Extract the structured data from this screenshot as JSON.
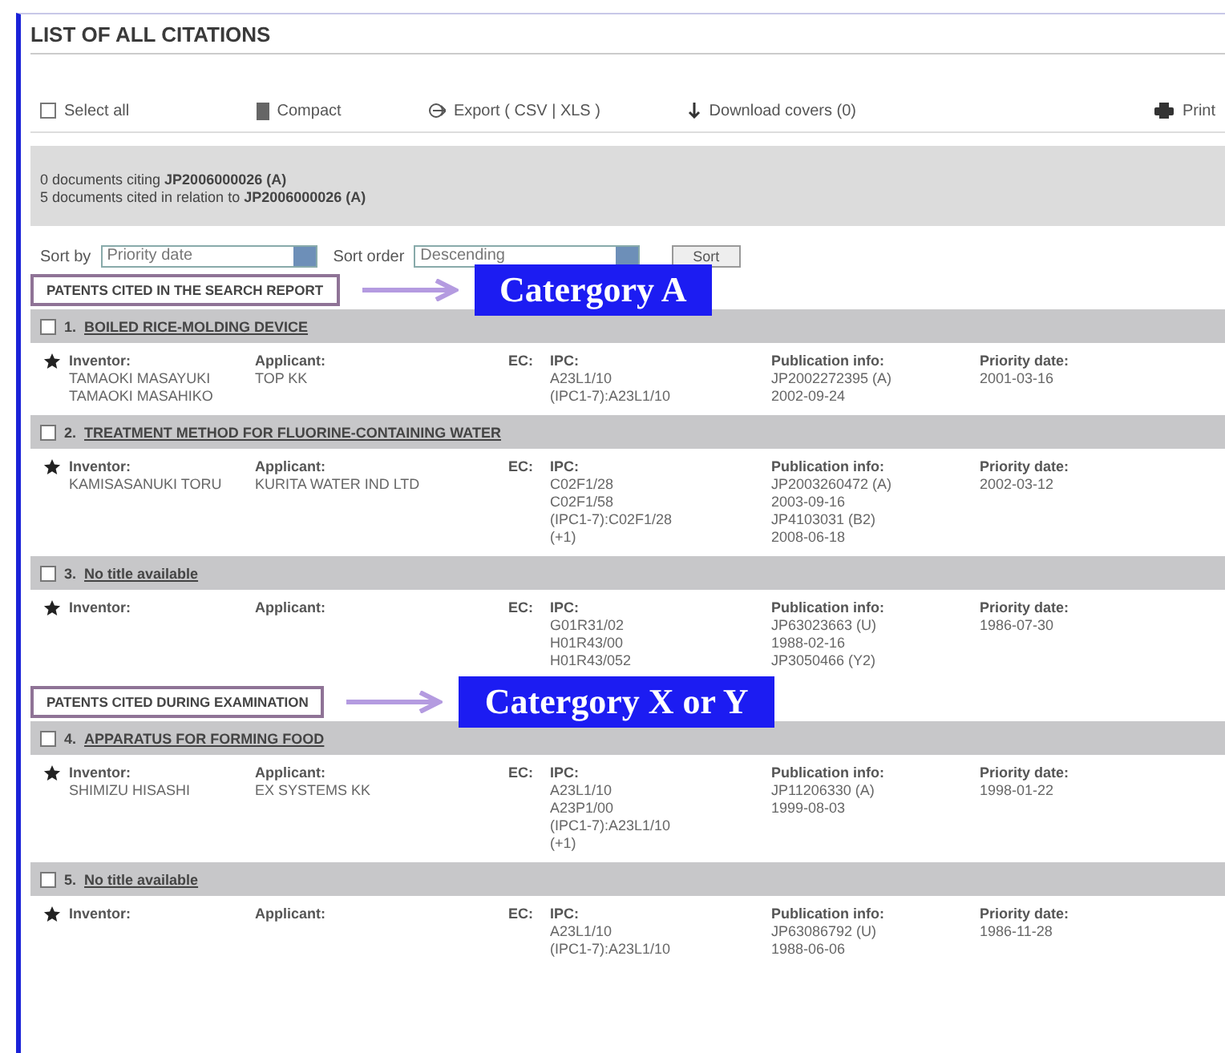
{
  "title": "LIST OF ALL CITATIONS",
  "toolbar": [
    {
      "kind": "checkbox",
      "label": "Select all",
      "checked": false
    },
    {
      "kind": "compact",
      "label": "Compact"
    },
    {
      "kind": "export",
      "label": "Export",
      "extra": "( CSV | XLS )"
    },
    {
      "kind": "download",
      "label": "Download covers (0)"
    },
    {
      "kind": "print",
      "label": "Print"
    }
  ],
  "summary": [
    "0 documents citing **JP2006000026 (A)**",
    "5 documents cited in relation to **JP2006000026 (A)**"
  ],
  "sort": {
    "sort_by_label": "Sort by",
    "sort_by": "Priority date",
    "order_label": "Sort order",
    "order": "Descending",
    "button": "Sort"
  },
  "sections": [
    {
      "heading": "PATENTS CITED IN THE SEARCH REPORT",
      "annotation": "Catergory A",
      "citations": [
        {
          "number": "1.",
          "title": "BOILED RICE-MOLDING DEVICE",
          "checked": false,
          "fields": [
            {
              "kind": "inventor",
              "label": "Inventor:",
              "values": [
                "TAMAOKI MASAYUKI",
                "TAMAOKI MASAHIKO"
              ]
            },
            {
              "kind": "applicant",
              "label": "Applicant:",
              "values": [
                "TOP KK"
              ]
            },
            {
              "kind": "ec",
              "label": "EC:"
            },
            {
              "kind": "ipc",
              "label": "IPC:",
              "values": [
                "A23L1/10",
                "(IPC1-7):A23L1/10"
              ]
            },
            {
              "kind": "publication",
              "label": "Publication info:",
              "values": [
                "JP2002272395 (A)",
                "2002-09-24"
              ]
            },
            {
              "kind": "priority-date",
              "label": "Priority date:",
              "values": [
                "2001-03-16"
              ]
            }
          ]
        },
        {
          "number": "2.",
          "title": "TREATMENT METHOD FOR FLUORINE-CONTAINING WATER",
          "checked": false,
          "fields": [
            {
              "kind": "inventor",
              "label": "Inventor:",
              "values": [
                "KAMISASANUKI TORU"
              ]
            },
            {
              "kind": "applicant",
              "label": "Applicant:",
              "values": [
                "KURITA WATER IND LTD"
              ]
            },
            {
              "kind": "ec",
              "label": "EC:"
            },
            {
              "kind": "ipc",
              "label": "IPC:",
              "values": [
                "C02F1/28",
                "C02F1/58",
                "(IPC1-7):C02F1/28",
                "(+1)"
              ]
            },
            {
              "kind": "publication",
              "label": "Publication info:",
              "values": [
                "JP2003260472 (A)",
                "2003-09-16",
                "JP4103031 (B2)",
                "2008-06-18"
              ]
            },
            {
              "kind": "priority-date",
              "label": "Priority date:",
              "values": [
                "2002-03-12"
              ]
            }
          ]
        },
        {
          "number": "3.",
          "title": "No title available",
          "checked": false,
          "fields": [
            {
              "kind": "inventor",
              "label": "Inventor:"
            },
            {
              "kind": "applicant",
              "label": "Applicant:"
            },
            {
              "kind": "ec",
              "label": "EC:"
            },
            {
              "kind": "ipc",
              "label": "IPC:",
              "values": [
                "G01R31/02",
                "H01R43/00",
                "H01R43/052"
              ]
            },
            {
              "kind": "publication",
              "label": "Publication info:",
              "values": [
                "JP63023663 (U)",
                "1988-02-16",
                "JP3050466 (Y2)"
              ]
            },
            {
              "kind": "priority-date",
              "label": "Priority date:",
              "values": [
                "1986-07-30"
              ]
            }
          ]
        }
      ]
    },
    {
      "heading": "PATENTS CITED DURING EXAMINATION",
      "annotation": "Catergory X or Y",
      "citations": [
        {
          "number": "4.",
          "title": "APPARATUS FOR FORMING FOOD",
          "checked": false,
          "fields": [
            {
              "kind": "inventor",
              "label": "Inventor:",
              "values": [
                "SHIMIZU HISASHI"
              ]
            },
            {
              "kind": "applicant",
              "label": "Applicant:",
              "values": [
                "EX SYSTEMS KK"
              ]
            },
            {
              "kind": "ec",
              "label": "EC:"
            },
            {
              "kind": "ipc",
              "label": "IPC:",
              "values": [
                "A23L1/10",
                "A23P1/00",
                "(IPC1-7):A23L1/10",
                "(+1)"
              ]
            },
            {
              "kind": "publication",
              "label": "Publication info:",
              "values": [
                "JP11206330 (A)",
                "1999-08-03"
              ]
            },
            {
              "kind": "priority-date",
              "label": "Priority date:",
              "values": [
                "1998-01-22"
              ]
            }
          ]
        },
        {
          "number": "5.",
          "title": "No title available",
          "checked": false,
          "fields": [
            {
              "kind": "inventor",
              "label": "Inventor:"
            },
            {
              "kind": "applicant",
              "label": "Applicant:"
            },
            {
              "kind": "ec",
              "label": "EC:"
            },
            {
              "kind": "ipc",
              "label": "IPC:",
              "values": [
                "A23L1/10",
                "(IPC1-7):A23L1/10"
              ]
            },
            {
              "kind": "publication",
              "label": "Publication info:",
              "values": [
                "JP63086792 (U)",
                "1988-06-06"
              ]
            },
            {
              "kind": "priority-date",
              "label": "Priority date:",
              "values": [
                "1986-11-28"
              ]
            }
          ]
        }
      ]
    }
  ]
}
